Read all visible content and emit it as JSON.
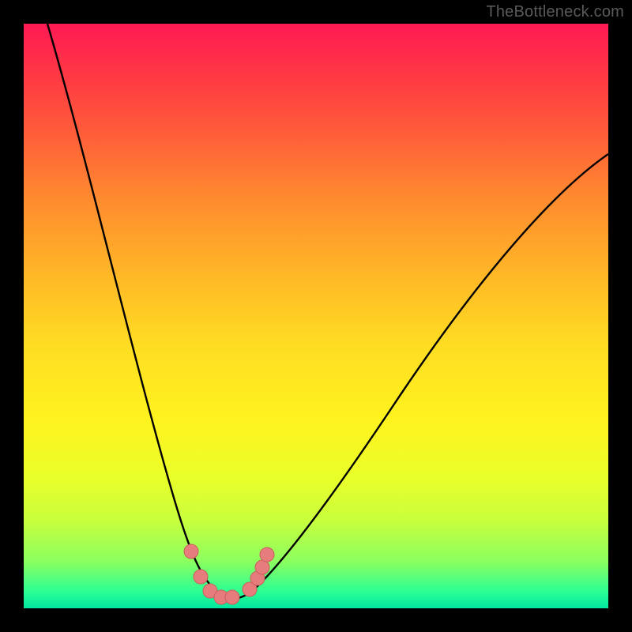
{
  "watermark": "TheBottleneck.com",
  "colors": {
    "top": "#ff1a54",
    "mid": "#fff31f",
    "bottom": "#00e6a0",
    "frame": "#000000",
    "curve": "#000000",
    "points": "#e77c7c"
  },
  "chart_data": {
    "type": "line",
    "title": "",
    "xlabel": "",
    "ylabel": "",
    "xlim": [
      0,
      100
    ],
    "ylim": [
      0,
      100
    ],
    "annotations": [
      "gradient background from red (high bottleneck) to green (optimal)"
    ],
    "series": [
      {
        "name": "bottleneck-curve",
        "x": [
          4,
          8,
          12,
          16,
          20,
          23,
          26,
          29,
          31,
          33,
          35,
          37,
          40,
          45,
          50,
          55,
          60,
          65,
          70,
          75,
          80,
          85,
          90,
          95,
          100
        ],
        "y": [
          100,
          86,
          72,
          58,
          44,
          33,
          23,
          14,
          8,
          4,
          2,
          3,
          6,
          12,
          19,
          26,
          33,
          40,
          46,
          52,
          58,
          63,
          68,
          72,
          75
        ]
      },
      {
        "name": "highlighted-points",
        "x": [
          28.5,
          30.0,
          31.5,
          33.0,
          34.5,
          37.0,
          38.5,
          39.5,
          40.0
        ],
        "y": [
          9,
          5,
          3,
          2,
          2,
          3,
          5,
          7,
          9
        ]
      }
    ]
  }
}
